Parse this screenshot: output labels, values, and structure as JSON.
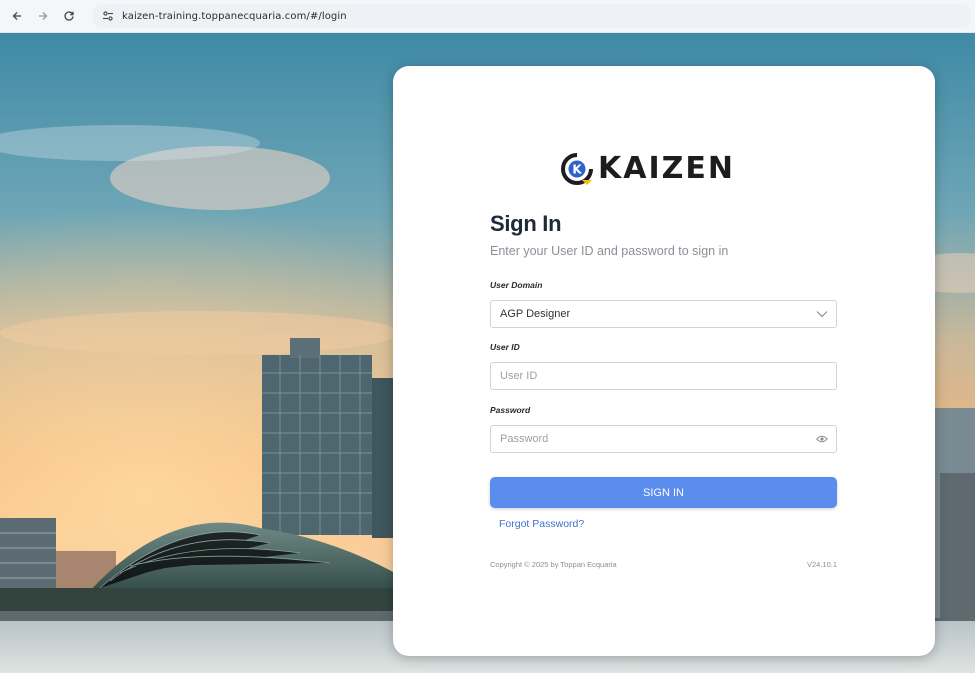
{
  "browser": {
    "url": "kaizen-training.toppanecquaria.com/#/login"
  },
  "brand": {
    "name": "KAIZEN",
    "logo_letter": "K",
    "colors": {
      "blue": "#2f62c9",
      "yellow": "#f2c200",
      "dark": "#1d1d1f"
    }
  },
  "login": {
    "title": "Sign In",
    "subtitle": "Enter your User ID and password to sign in",
    "domain_label": "User Domain",
    "domain_value": "AGP Designer",
    "userid_label": "User ID",
    "userid_placeholder": "User ID",
    "password_label": "Password",
    "password_placeholder": "Password",
    "signin_label": "SIGN IN",
    "forgot_label": "Forgot Password?",
    "copyright": "Copyright © 2025 by Toppan Ecquaria",
    "version": "V24.10.1"
  },
  "colors": {
    "accent": "#5b8def",
    "link": "#3f72c9"
  }
}
